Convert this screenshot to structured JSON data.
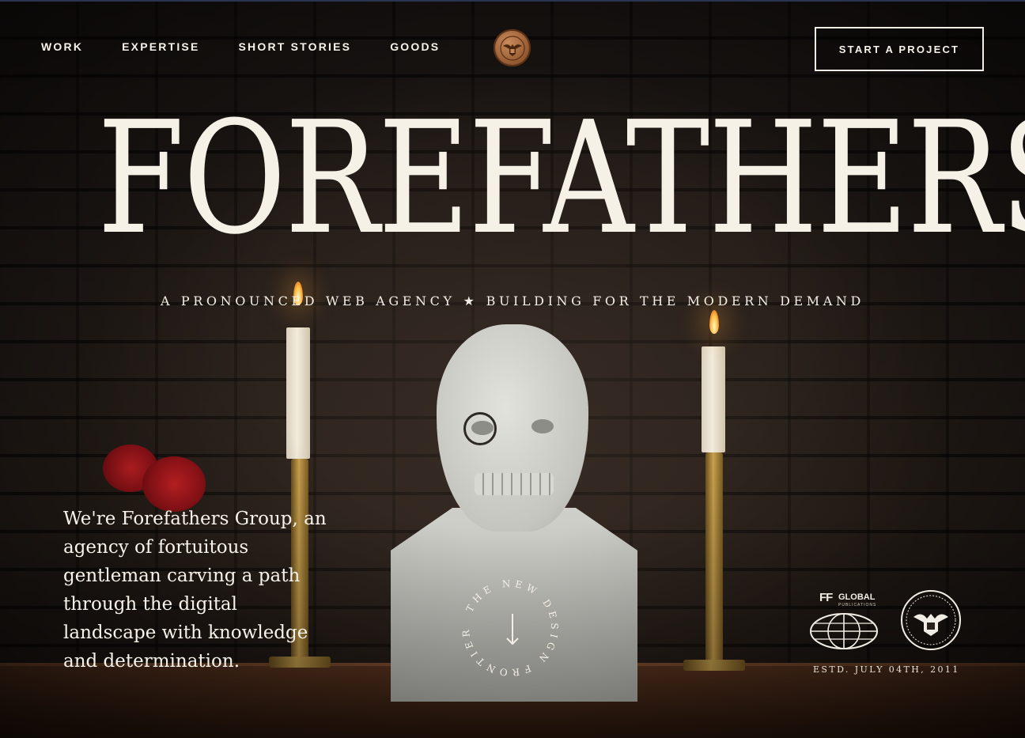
{
  "nav": {
    "items": [
      {
        "label": "WORK"
      },
      {
        "label": "EXPERTISE"
      },
      {
        "label": "SHORT STORIES"
      },
      {
        "label": "GOODS"
      }
    ],
    "logo_icon": "eagle-seal-icon",
    "cta_label": "START A PROJECT"
  },
  "hero": {
    "title": "FOREFATHERS",
    "tagline_left": "A PRONOUNCED WEB AGENCY",
    "tagline_star": "★",
    "tagline_right": "BUILDING FOR THE MODERN DEMAND",
    "intro": "We're Forefathers Group, an agency of fortuitous gentleman carving a path through the digital landscape with knowledge and determination.",
    "badge_text": "THE NEW DESIGN FRONTIER",
    "scroll_icon": "arrow-down-icon"
  },
  "footer_badges": {
    "ff_mark": "FF",
    "global_label": "GLOBAL",
    "global_sub": "PUBLICATIONS",
    "globe_icon": "globe-icon",
    "seal_icon": "presidential-seal-icon",
    "established": "ESTD. JULY 04TH, 2011"
  },
  "colors": {
    "text": "#f4efe6",
    "seal_copper": "#a8683c",
    "background": "#1a1411"
  }
}
